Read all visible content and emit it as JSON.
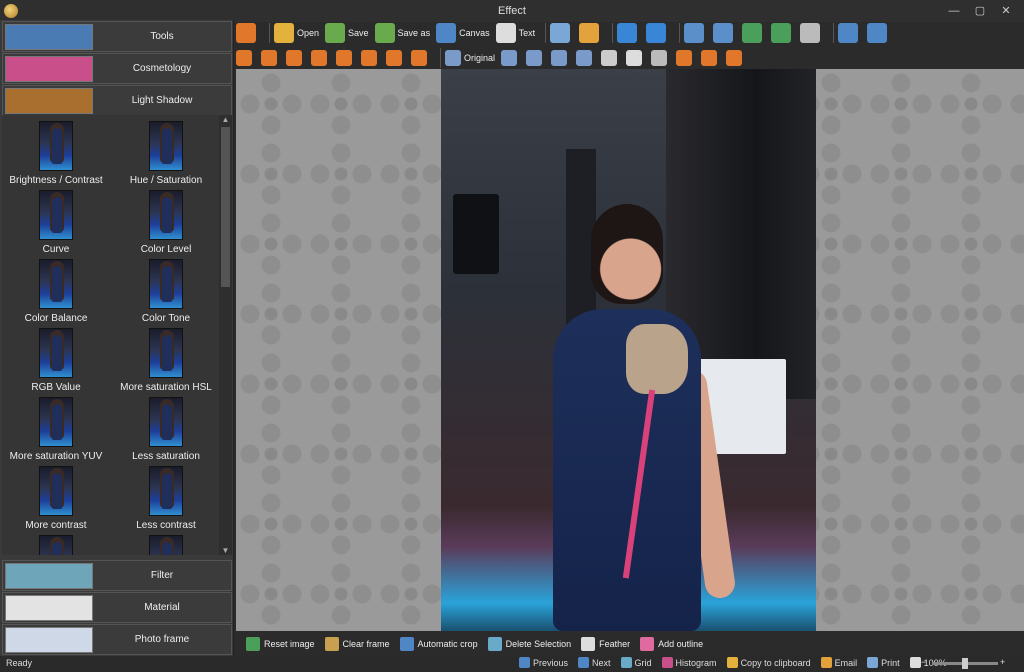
{
  "window": {
    "title": "Effect",
    "buttons": [
      "—",
      "▢",
      "✕"
    ]
  },
  "sidebar": {
    "categories": [
      {
        "label": "Tools",
        "thumb_color": "#4a7bb3"
      },
      {
        "label": "Cosmetology",
        "thumb_color": "#c94f8a"
      },
      {
        "label": "Light Shadow",
        "thumb_color": "#a86f2e"
      },
      {
        "label": "Filter",
        "thumb_color": "#6fa5b8"
      },
      {
        "label": "Material",
        "thumb_color": "#e3e3e3"
      },
      {
        "label": "Photo frame",
        "thumb_color": "#cfd8e6"
      }
    ],
    "effects": [
      "Brightness / Contrast",
      "Hue / Saturation",
      "Curve",
      "Color Level",
      "Color Balance",
      "Color Tone",
      "RGB Value",
      "More saturation HSL",
      "More saturation YUV",
      "Less saturation",
      "More contrast",
      "Less contrast",
      "",
      ""
    ]
  },
  "toolbar": {
    "items": [
      {
        "label": "",
        "icon": "back-arrow-icon",
        "color": "#e0772a"
      },
      {
        "label": "Open",
        "icon": "open-folder-icon",
        "color": "#e3b23c"
      },
      {
        "label": "Save",
        "icon": "save-icon",
        "color": "#6aaa4e"
      },
      {
        "label": "Save as",
        "icon": "save-as-icon",
        "color": "#6aaa4e"
      },
      {
        "label": "Canvas",
        "icon": "canvas-icon",
        "color": "#4f86c6"
      },
      {
        "label": "Text",
        "icon": "text-icon",
        "color": "#dddddd"
      },
      {
        "label": "",
        "icon": "print-icon",
        "color": "#7aa7d6"
      },
      {
        "label": "",
        "icon": "email-icon",
        "color": "#e3a23c"
      },
      {
        "label": "",
        "icon": "undo-icon",
        "color": "#3a86d6"
      },
      {
        "label": "",
        "icon": "redo-icon",
        "color": "#3a86d6"
      },
      {
        "label": "",
        "icon": "flip-vertical-icon",
        "color": "#5b8fc9"
      },
      {
        "label": "",
        "icon": "flip-horizontal-icon",
        "color": "#5b8fc9"
      },
      {
        "label": "",
        "icon": "rotate-left-icon",
        "color": "#4aa05a"
      },
      {
        "label": "",
        "icon": "rotate-right-icon",
        "color": "#4aa05a"
      },
      {
        "label": "",
        "icon": "rotate-free-icon",
        "color": "#bbbbbb"
      },
      {
        "label": "",
        "icon": "zoom-in-icon",
        "color": "#4f86c6"
      },
      {
        "label": "",
        "icon": "zoom-out-icon",
        "color": "#4f86c6"
      }
    ],
    "selection_tools": [
      {
        "label": "",
        "icon": "pointer-icon",
        "color": "#e0772a"
      },
      {
        "label": "",
        "icon": "rect-select-icon",
        "color": "#e0772a"
      },
      {
        "label": "",
        "icon": "rounded-rect-select-icon",
        "color": "#e0772a"
      },
      {
        "label": "",
        "icon": "ellipse-select-icon",
        "color": "#e0772a"
      },
      {
        "label": "",
        "icon": "heart-select-icon",
        "color": "#e0772a"
      },
      {
        "label": "",
        "icon": "polygon-select-icon",
        "color": "#e0772a"
      },
      {
        "label": "",
        "icon": "lasso-select-icon",
        "color": "#e0772a"
      },
      {
        "label": "",
        "icon": "magic-wand-icon",
        "color": "#e0772a"
      },
      {
        "label": "Original",
        "icon": "original-icon",
        "color": "#7a9bc9"
      },
      {
        "label": "",
        "icon": "photo-tool-1-icon",
        "color": "#7a9bc9"
      },
      {
        "label": "",
        "icon": "photo-tool-2-icon",
        "color": "#7a9bc9"
      },
      {
        "label": "",
        "icon": "photo-tool-3-icon",
        "color": "#7a9bc9"
      },
      {
        "label": "",
        "icon": "photo-tool-4-icon",
        "color": "#7a9bc9"
      },
      {
        "label": "",
        "icon": "scissors-icon",
        "color": "#cccccc"
      },
      {
        "label": "",
        "icon": "checkerboard-icon",
        "color": "#dddddd"
      },
      {
        "label": "",
        "icon": "grid-perspective-icon",
        "color": "#bbbbbb"
      },
      {
        "label": "",
        "icon": "hash-grid-icon",
        "color": "#e0772a"
      },
      {
        "label": "",
        "icon": "hash-grid-2-icon",
        "color": "#e0772a"
      },
      {
        "label": "",
        "icon": "hash-grid-3-icon",
        "color": "#e0772a"
      }
    ]
  },
  "actionbar": [
    {
      "label": "Reset image",
      "icon": "reset-icon",
      "color": "#4aa05a"
    },
    {
      "label": "Clear frame",
      "icon": "clear-frame-icon",
      "color": "#c9a04f"
    },
    {
      "label": "Automatic crop",
      "icon": "auto-crop-icon",
      "color": "#4f86c6"
    },
    {
      "label": "Delete Selection",
      "icon": "delete-selection-icon",
      "color": "#6aaac9"
    },
    {
      "label": "Feather",
      "icon": "feather-icon",
      "color": "#dddddd"
    },
    {
      "label": "Add outline",
      "icon": "add-outline-icon",
      "color": "#e06aa0"
    }
  ],
  "statusbar": {
    "status": "Ready",
    "items": [
      {
        "label": "Previous",
        "icon": "previous-icon",
        "color": "#4f86c6"
      },
      {
        "label": "Next",
        "icon": "next-icon",
        "color": "#4f86c6"
      },
      {
        "label": "Grid",
        "icon": "grid-icon",
        "color": "#6aaac9"
      },
      {
        "label": "Histogram",
        "icon": "histogram-icon",
        "color": "#c94f8a"
      },
      {
        "label": "Copy to clipboard",
        "icon": "clipboard-icon",
        "color": "#e3b23c"
      },
      {
        "label": "Email",
        "icon": "email-icon",
        "color": "#e3a23c"
      },
      {
        "label": "Print",
        "icon": "print-icon",
        "color": "#7aa7d6"
      },
      {
        "label": "100%",
        "icon": "zoom-icon",
        "color": "#dddddd"
      }
    ],
    "zoom_minus": "−",
    "zoom_plus": "+",
    "zoom_level": 0.5
  }
}
